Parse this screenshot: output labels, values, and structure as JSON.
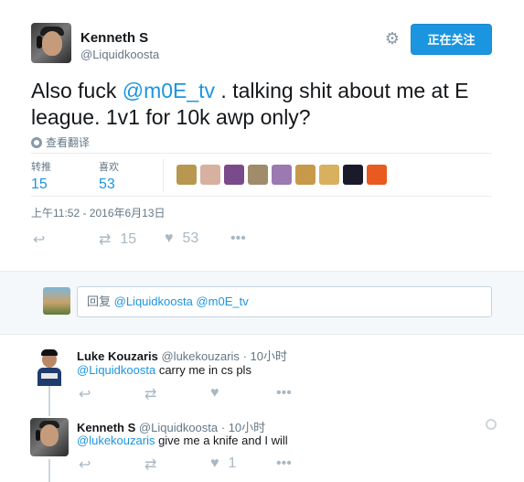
{
  "main_tweet": {
    "author_name": "Kenneth S",
    "author_handle": "@Liquidkoosta",
    "follow_label": "正在关注",
    "text_before": "Also fuck ",
    "text_mention": "@m0E_tv",
    "text_after": " . talking shit about me at E league. 1v1 for 10k awp only?",
    "translate_label": "查看翻译",
    "retweets_label": "转推",
    "retweets_count": "15",
    "likes_label": "喜欢",
    "likes_count": "53",
    "timestamp": "上午11:52 - 2016年6月13日",
    "action_retweet_count": "15",
    "action_like_count": "53",
    "liker_colors": [
      "#b89850",
      "#d8b0a0",
      "#7a4b8a",
      "#a08c6a",
      "#9a7ab0",
      "#c79a4a",
      "#d8b060",
      "#1a1a2a",
      "#e85a20"
    ]
  },
  "reply_box": {
    "prefix": "回复 ",
    "mentions": "@Liquidkoosta @m0E_tv"
  },
  "replies": [
    {
      "name": "Luke Kouzaris",
      "handle": "@lukekouzaris",
      "time": "· 10小时",
      "mention": "@Liquidkoosta",
      "text": " carry me in cs pls",
      "like_count": ""
    },
    {
      "name": "Kenneth S",
      "handle": "@Liquidkoosta",
      "time": "· 10小时",
      "mention": "@lukekouzaris",
      "text": " give me a knife and I will",
      "like_count": "1"
    }
  ],
  "icons": {
    "gear": "gear-icon",
    "reply": "reply-icon",
    "retweet": "retweet-icon",
    "like": "heart-icon",
    "more": "more-icon",
    "globe": "globe-icon"
  },
  "colors": {
    "accent": "#1b95e0",
    "muted": "#657786",
    "icon": "#aab8c2"
  }
}
